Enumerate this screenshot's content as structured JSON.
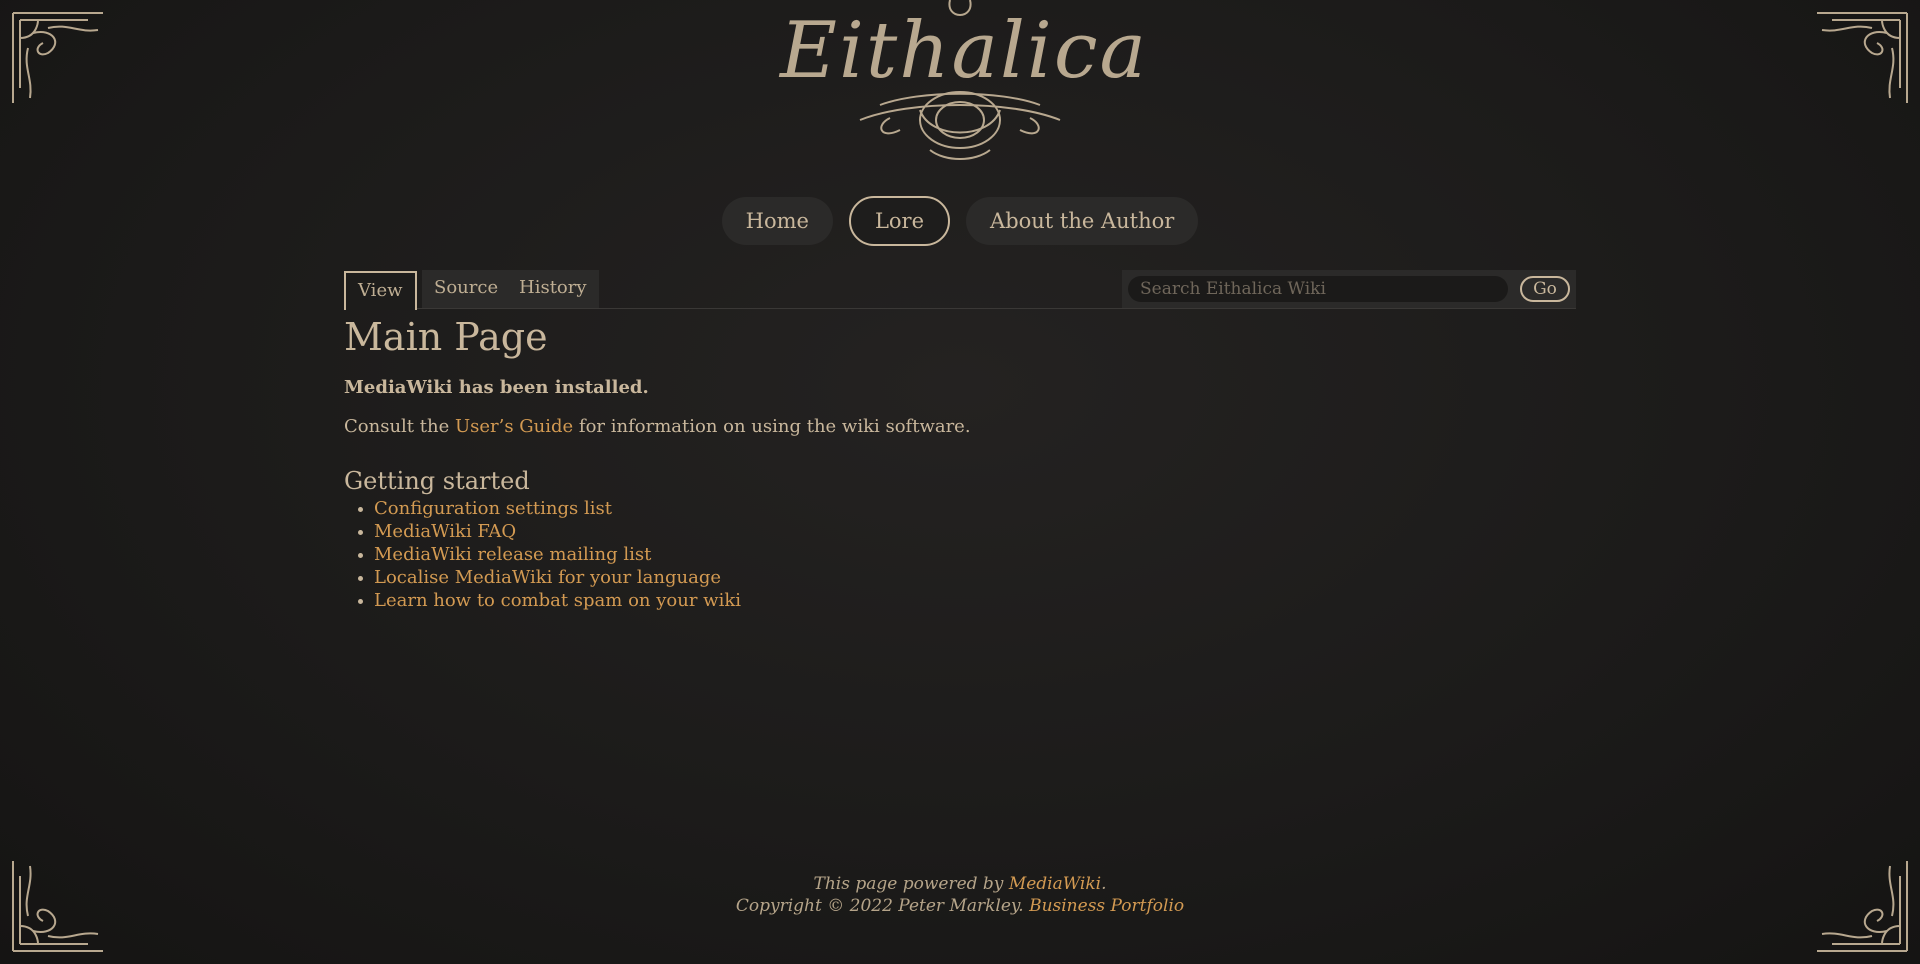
{
  "brand": {
    "logo_text": "Eithalica",
    "accent": "#d39a52",
    "text_color": "#c9b79c"
  },
  "nav": {
    "home": "Home",
    "lore": "Lore",
    "about": "About the Author"
  },
  "tabs": {
    "view": "View",
    "source": "Source",
    "history": "History"
  },
  "search": {
    "placeholder": "Search Eithalica Wiki",
    "go_label": "Go"
  },
  "main": {
    "title": "Main Page",
    "installed": "MediaWiki has been installed.",
    "consult_pre": "Consult the ",
    "consult_link": "User’s Guide",
    "consult_post": " for information on using the wiki software.",
    "section_title": "Getting started",
    "links": [
      "Configuration settings list",
      "MediaWiki FAQ",
      "MediaWiki release mailing list",
      "Localise MediaWiki for your language",
      "Learn how to combat spam on your wiki"
    ]
  },
  "footer": {
    "powered_pre": "This page powered by ",
    "powered_link": "MediaWiki",
    "powered_post": ".",
    "copyright": "Copyright © 2022 Peter Markley. ",
    "portfolio_link": "Business Portfolio"
  }
}
